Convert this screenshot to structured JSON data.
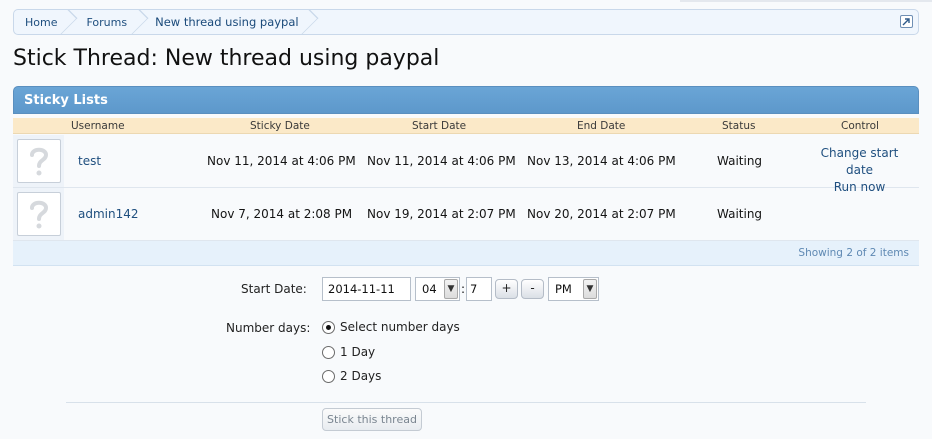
{
  "breadcrumb": {
    "home": "Home",
    "forums": "Forums",
    "current": "New thread using paypal",
    "jump_icon": "external-jump-icon"
  },
  "page_title": "Stick Thread: New thread using paypal",
  "panel": {
    "title": "Sticky Lists",
    "columns": {
      "username": "Username",
      "sticky_date": "Sticky Date",
      "start_date": "Start Date",
      "end_date": "End Date",
      "status": "Status",
      "control": "Control"
    },
    "rows": [
      {
        "avatar_icon": "default-avatar-question-icon",
        "username": "test",
        "sticky_date": "Nov 11, 2014 at 4:06 PM",
        "start_date": "Nov 11, 2014 at 4:06 PM",
        "end_date": "Nov 13, 2014 at 4:06 PM",
        "status": "Waiting",
        "controls": [
          "Change start date",
          "Run now"
        ]
      },
      {
        "avatar_icon": "default-avatar-question-icon",
        "username": "admin142",
        "sticky_date": "Nov 7, 2014 at 2:08 PM",
        "start_date": "Nov 19, 2014 at 2:07 PM",
        "end_date": "Nov 20, 2014 at 2:07 PM",
        "status": "Waiting",
        "controls": []
      }
    ],
    "footer": "Showing 2 of 2 items"
  },
  "form": {
    "start_date_label": "Start Date:",
    "date_value": "2014-11-11",
    "hour_value": "04",
    "separator": ":",
    "minute_value": "7",
    "plus_label": "+",
    "minus_label": "-",
    "ampm_value": "PM",
    "number_days_label": "Number days:",
    "options": [
      {
        "label": "Select number days",
        "checked": true
      },
      {
        "label": "1 Day",
        "checked": false
      },
      {
        "label": "2 Days",
        "checked": false
      }
    ],
    "submit_label": "Stick this thread"
  },
  "colors": {
    "panel_header": "#5d98cb",
    "column_header": "#fbe9c8",
    "link": "#1f4f7f"
  }
}
